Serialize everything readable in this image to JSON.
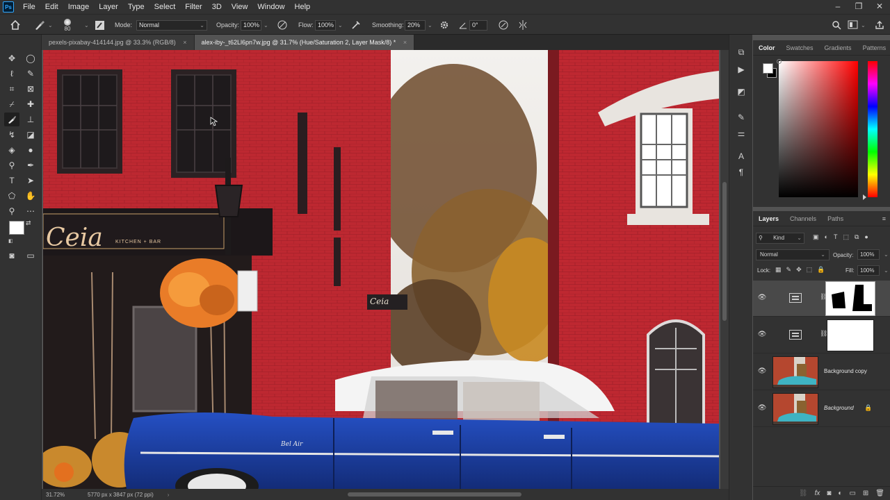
{
  "app": {
    "logo": "Ps"
  },
  "menu": [
    "File",
    "Edit",
    "Image",
    "Layer",
    "Type",
    "Select",
    "Filter",
    "3D",
    "View",
    "Window",
    "Help"
  ],
  "window_controls": {
    "minimize": "–",
    "restore": "❐",
    "close": "✕"
  },
  "options": {
    "brush_size": "80",
    "mode_label": "Mode:",
    "mode_value": "Normal",
    "opacity_label": "Opacity:",
    "opacity_value": "100%",
    "flow_label": "Flow:",
    "flow_value": "100%",
    "smoothing_label": "Smoothing:",
    "smoothing_value": "20%",
    "angle_value": "0°"
  },
  "tabs": [
    {
      "label": "pexels-pixabay-414144.jpg @ 33.3% (RGB/8)",
      "close": "×"
    },
    {
      "label": "alex-iby-_t62Ll6pn7w.jpg @ 31.7% (Hue/Saturation 2, Layer Mask/8) *",
      "close": "×"
    }
  ],
  "status": {
    "zoom": "31.72%",
    "doc_info": "5770 px x 3847 px (72 ppi)"
  },
  "canvas_signs": {
    "restaurant": "Ceia",
    "restaurant_sub": "KITCHEN + BAR",
    "hanging_sign": "Ceia",
    "car_script": "Bel Air"
  },
  "color_panel": {
    "tabs": [
      "Color",
      "Swatches",
      "Gradients",
      "Patterns"
    ],
    "foreground": "#ffffff",
    "background": "#000000"
  },
  "layers_panel": {
    "tabs": [
      "Layers",
      "Channels",
      "Paths"
    ],
    "filter_kind": "Kind",
    "blend_mode": "Normal",
    "opacity_label": "Opacity:",
    "opacity_value": "100%",
    "lock_label": "Lock:",
    "fill_label": "Fill:",
    "fill_value": "100%",
    "layers": [
      {
        "name": ""
      },
      {
        "name": ""
      },
      {
        "name": "Background copy"
      },
      {
        "name": "Background"
      }
    ]
  },
  "colors": {
    "accent_brick": "#b92a2e",
    "car_blue": "#1d3e9e",
    "ui_dark": "#323232"
  }
}
